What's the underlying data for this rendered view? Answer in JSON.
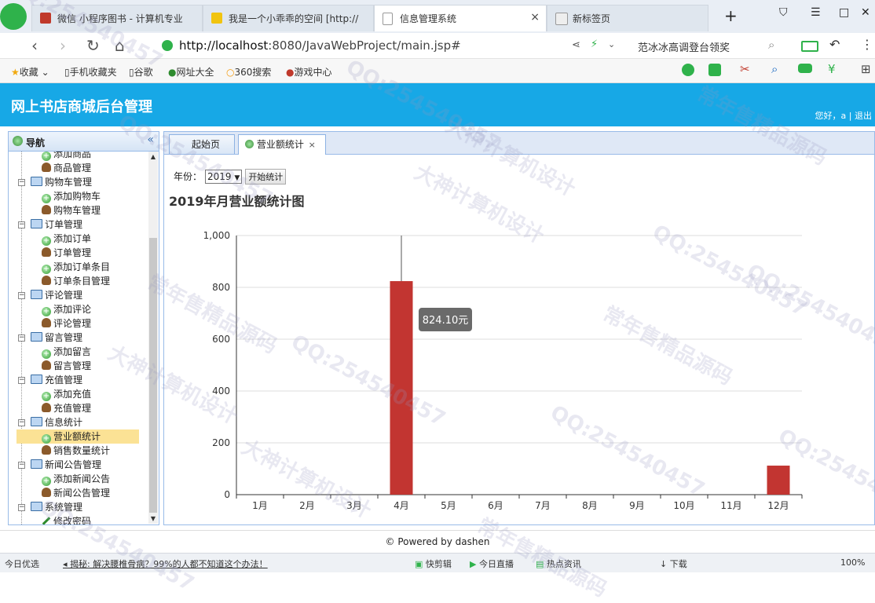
{
  "browser": {
    "tabs": [
      {
        "title": "微信 小程序图书 - 计算机专业",
        "active": false
      },
      {
        "title": "我是一个小乖乖的空间 [http://",
        "active": false
      },
      {
        "title": "信息管理系统",
        "active": true
      },
      {
        "title": "新标签页",
        "active": false
      }
    ],
    "url_host": "http://localhost",
    "url_rest": ":8080/JavaWebProject/main.jsp#",
    "search_text": "范冰冰高调登台领奖",
    "bookmarks": [
      "收藏",
      "手机收藏夹",
      "谷歌",
      "网址大全",
      "360搜索",
      "游戏中心"
    ]
  },
  "app": {
    "title": "网上书店商城后台管理",
    "user_greeting": "您好，a | 退出"
  },
  "nav": {
    "title": "导航",
    "collapse_glyph": "«",
    "items": [
      {
        "label": "添加商品",
        "level": 2,
        "icon": "plus"
      },
      {
        "label": "商品管理",
        "level": 2,
        "icon": "person"
      },
      {
        "label": "购物车管理",
        "level": 1,
        "icon": "monitor"
      },
      {
        "label": "添加购物车",
        "level": 2,
        "icon": "plus"
      },
      {
        "label": "购物车管理",
        "level": 2,
        "icon": "person"
      },
      {
        "label": "订单管理",
        "level": 1,
        "icon": "monitor"
      },
      {
        "label": "添加订单",
        "level": 2,
        "icon": "plus"
      },
      {
        "label": "订单管理",
        "level": 2,
        "icon": "person"
      },
      {
        "label": "添加订单条目",
        "level": 2,
        "icon": "plus"
      },
      {
        "label": "订单条目管理",
        "level": 2,
        "icon": "person"
      },
      {
        "label": "评论管理",
        "level": 1,
        "icon": "monitor"
      },
      {
        "label": "添加评论",
        "level": 2,
        "icon": "plus"
      },
      {
        "label": "评论管理",
        "level": 2,
        "icon": "person"
      },
      {
        "label": "留言管理",
        "level": 1,
        "icon": "monitor"
      },
      {
        "label": "添加留言",
        "level": 2,
        "icon": "plus"
      },
      {
        "label": "留言管理",
        "level": 2,
        "icon": "person"
      },
      {
        "label": "充值管理",
        "level": 1,
        "icon": "monitor"
      },
      {
        "label": "添加充值",
        "level": 2,
        "icon": "plus"
      },
      {
        "label": "充值管理",
        "level": 2,
        "icon": "person"
      },
      {
        "label": "信息统计",
        "level": 1,
        "icon": "monitor"
      },
      {
        "label": "营业额统计",
        "level": 2,
        "icon": "plus",
        "selected": true
      },
      {
        "label": "销售数量统计",
        "level": 2,
        "icon": "person"
      },
      {
        "label": "新闻公告管理",
        "level": 1,
        "icon": "monitor"
      },
      {
        "label": "添加新闻公告",
        "level": 2,
        "icon": "plus"
      },
      {
        "label": "新闻公告管理",
        "level": 2,
        "icon": "person"
      },
      {
        "label": "系统管理",
        "level": 1,
        "icon": "monitor"
      },
      {
        "label": "修改密码",
        "level": 2,
        "icon": "pencil"
      }
    ]
  },
  "tabs": {
    "start": "起始页",
    "current": "营业额统计",
    "close_glyph": "×"
  },
  "filters": {
    "year_label": "年份：",
    "year_value": "2019",
    "search_button": "开始统计"
  },
  "chart_title": "2019年月营业额统计图",
  "chart_data": {
    "type": "bar",
    "title": "2019年月营业额统计图",
    "categories": [
      "1月",
      "2月",
      "3月",
      "4月",
      "5月",
      "6月",
      "7月",
      "8月",
      "9月",
      "10月",
      "11月",
      "12月"
    ],
    "values": [
      0,
      0,
      0,
      824.1,
      0,
      0,
      0,
      0,
      0,
      0,
      0,
      112
    ],
    "ylim": [
      0,
      1000
    ],
    "yticks": [
      0,
      200,
      400,
      600,
      800,
      1000
    ],
    "ytick_labels": [
      "0",
      "200",
      "400",
      "600",
      "800",
      "1,000"
    ],
    "grid": true,
    "bar_color": "#c23531",
    "tooltip": {
      "category": "4月",
      "text": "824.10元"
    }
  },
  "footer": "© Powered by dashen",
  "statusbar": {
    "left": "今日优选",
    "news": "揭秘: 解决腰椎骨病？99%的人都不知道这个办法！",
    "items": [
      "快剪辑",
      "今日直播",
      "热点资讯",
      "下载"
    ],
    "zoom": "100%"
  },
  "watermarks": [
    "QQ:254540457",
    "大神计算机设计",
    "常年售精品源码"
  ]
}
